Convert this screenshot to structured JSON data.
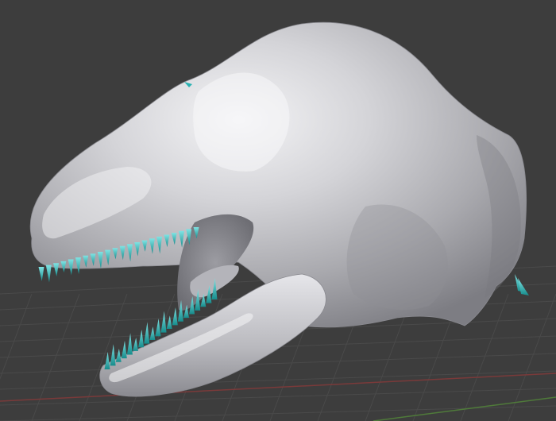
{
  "viewport": {
    "background": "#3d3d3d",
    "grid_color": "#4a4a4a",
    "x_axis_color": "#7a3a3a",
    "y_axis_color": "#4f7a3a"
  },
  "model": {
    "name": "dinosaur-head",
    "skin_color": "#c8c8cc",
    "tooth_color": "#2ab3b3"
  }
}
